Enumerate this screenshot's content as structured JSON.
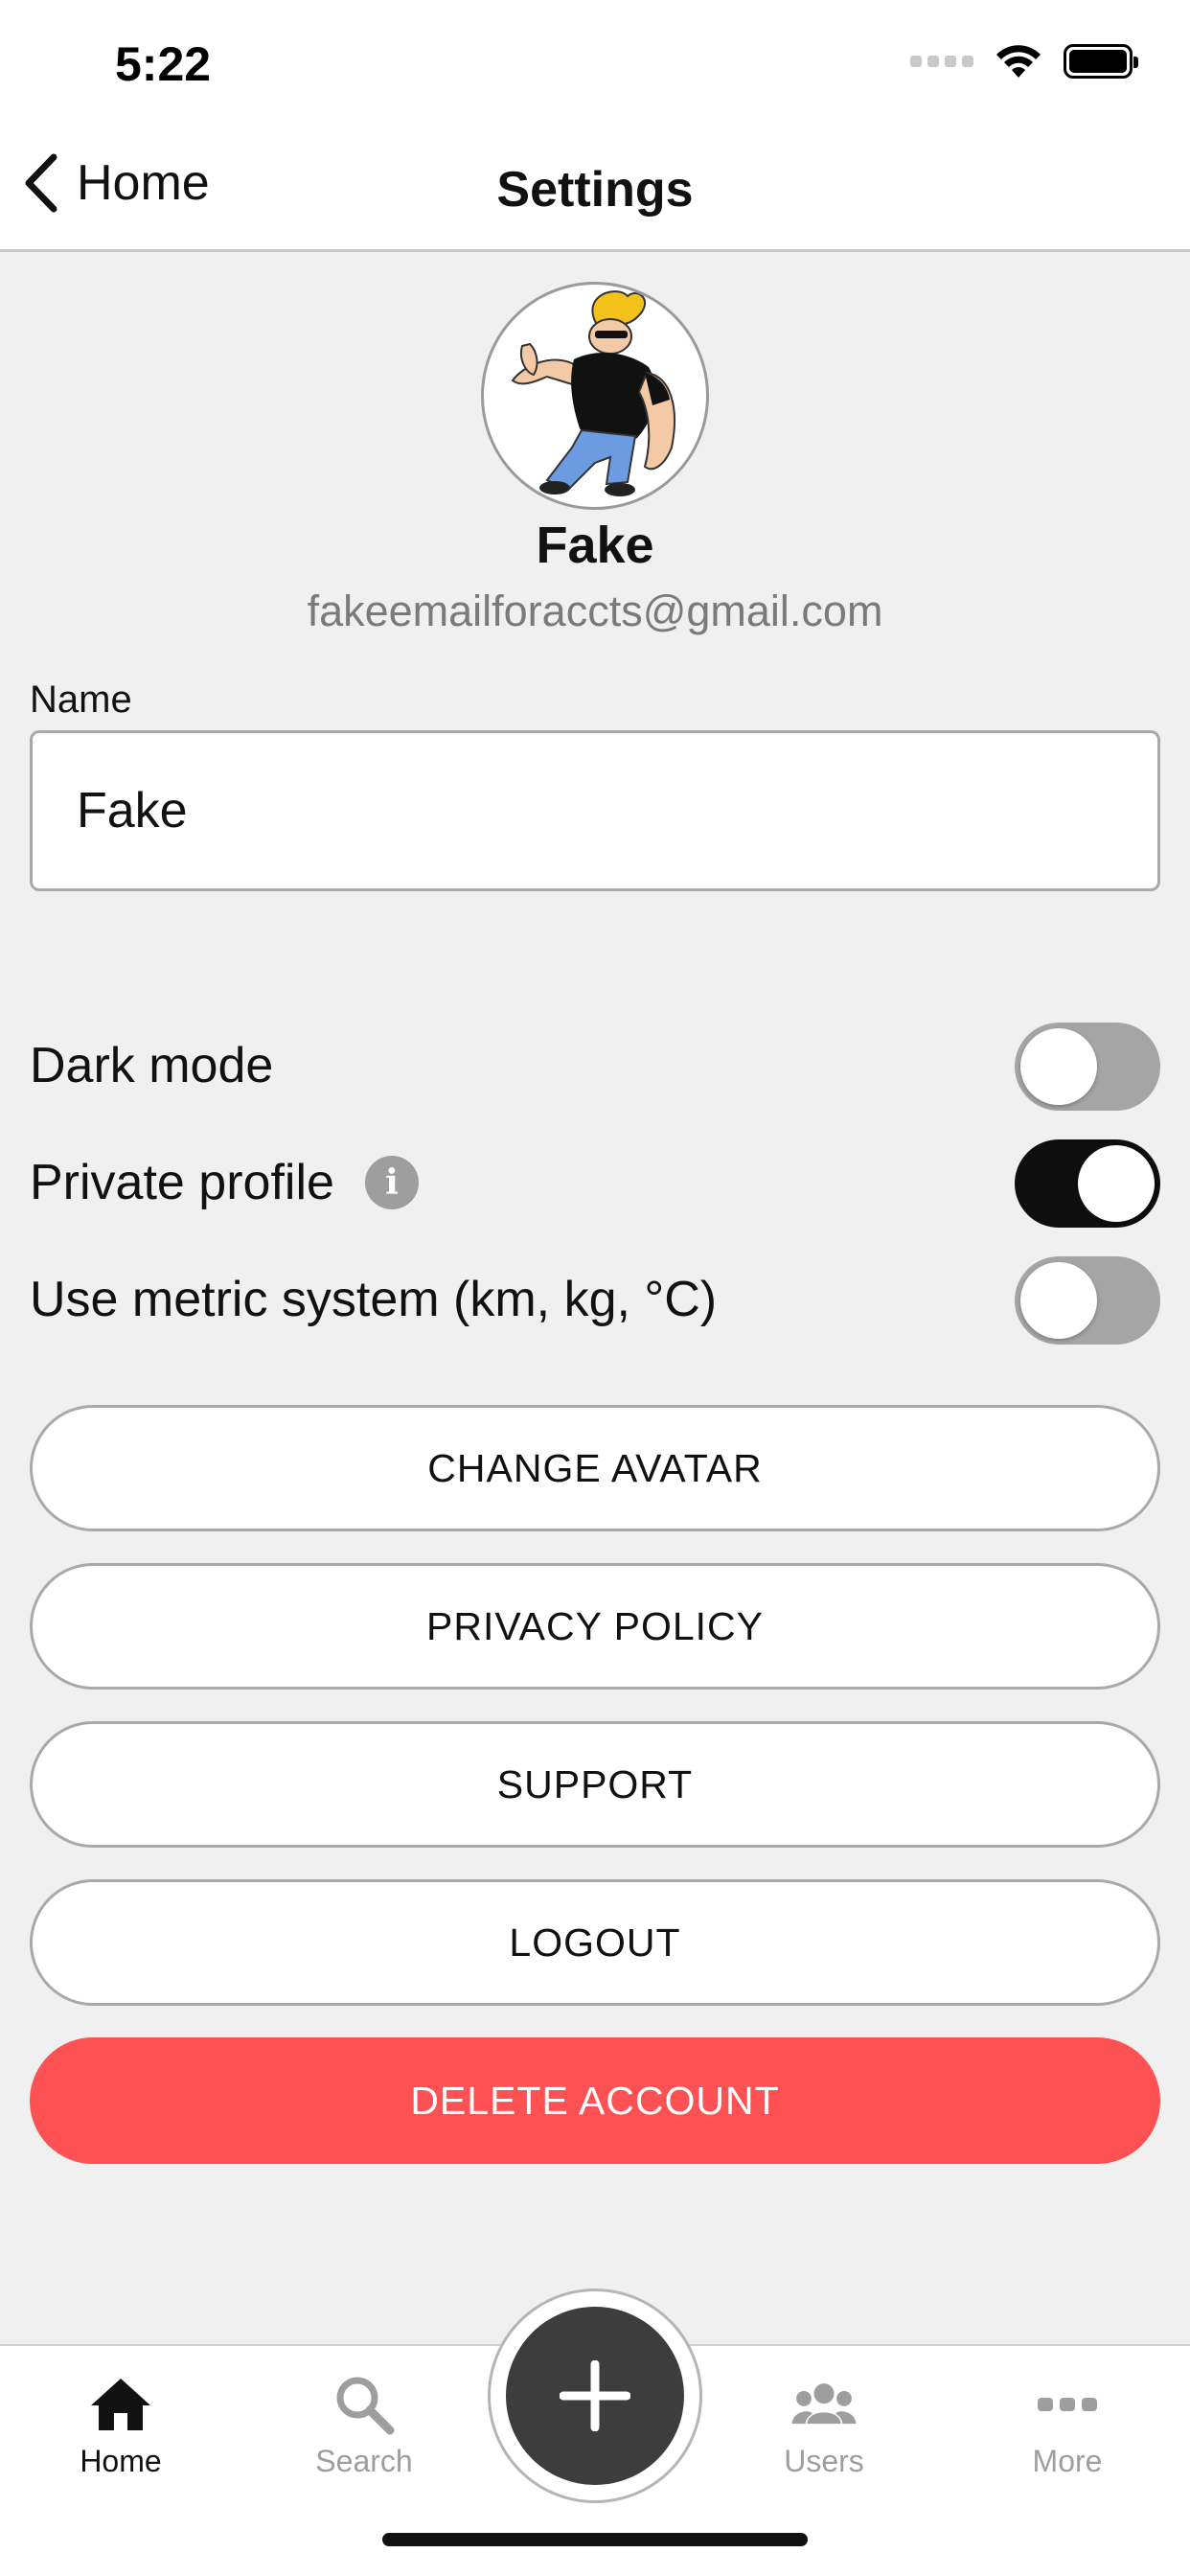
{
  "status_bar": {
    "time": "5:22"
  },
  "nav": {
    "back_label": "Home",
    "title": "Settings"
  },
  "profile": {
    "name": "Fake",
    "email": "fakeemailforaccts@gmail.com"
  },
  "name_field": {
    "label": "Name",
    "value": "Fake"
  },
  "toggles": [
    {
      "label": "Dark mode",
      "on": false
    },
    {
      "label": "Private profile",
      "on": true,
      "has_info_icon": true
    },
    {
      "label": "Use metric system (km, kg, °C)",
      "on": false
    }
  ],
  "buttons": {
    "change_avatar": "CHANGE AVATAR",
    "privacy_policy": "PRIVACY POLICY",
    "support": "SUPPORT",
    "logout": "LOGOUT",
    "delete_account": "DELETE ACCOUNT"
  },
  "tabbar": {
    "items": [
      {
        "label": "Home",
        "icon": "home-icon",
        "active": true
      },
      {
        "label": "Search",
        "icon": "search-icon",
        "active": false
      },
      {
        "label": "Users",
        "icon": "users-icon",
        "active": false
      },
      {
        "label": "More",
        "icon": "more-icon",
        "active": false
      }
    ],
    "center_action_icon": "plus-icon"
  },
  "colors": {
    "background": "#f0f0f0",
    "danger": "#fe5153",
    "toggle_on": "#0e0e0e",
    "toggle_off": "#a5a5a5",
    "fab": "#3d3d3d"
  }
}
